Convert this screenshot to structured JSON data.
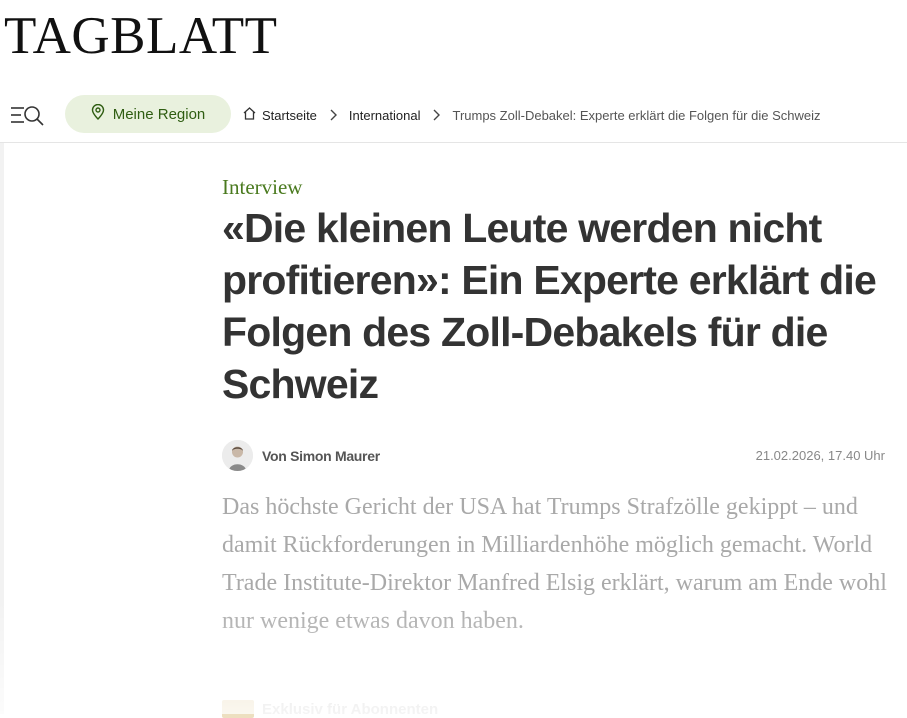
{
  "brand": {
    "logo": "TAGBLATT"
  },
  "nav": {
    "menu_icon": "menu-search-icon",
    "region_icon": "location-pin-icon",
    "region_label": "Meine Region",
    "breadcrumb": {
      "home_icon": "home-icon",
      "home": "Startseite",
      "section": "International",
      "current": "Trumps Zoll-Debakel: Experte erklärt die Folgen für die Schweiz"
    }
  },
  "article": {
    "kicker": "Interview",
    "headline": "«Die kleinen Leute werden nicht profitieren»: Ein Experte erklärt die Folgen des Zoll-Debakels für die Schweiz",
    "author": "Von Simon Maurer",
    "date": "21.02.2026, 17.40 Uhr",
    "lead": "Das höchste Gericht der USA hat Trumps Strafzölle gekippt – und damit Rückforderungen in Milliardenhöhe möglich gemacht. World Trade Institute-Direktor Manfred Elsig erklärt, warum am Ende wohl nur wenige etwas davon haben.",
    "exclusive_label": "Exklusiv für Abonnenten"
  },
  "colors": {
    "accent_green": "#4a7a1f",
    "region_bg": "#e9f1de",
    "headline": "#333333"
  }
}
